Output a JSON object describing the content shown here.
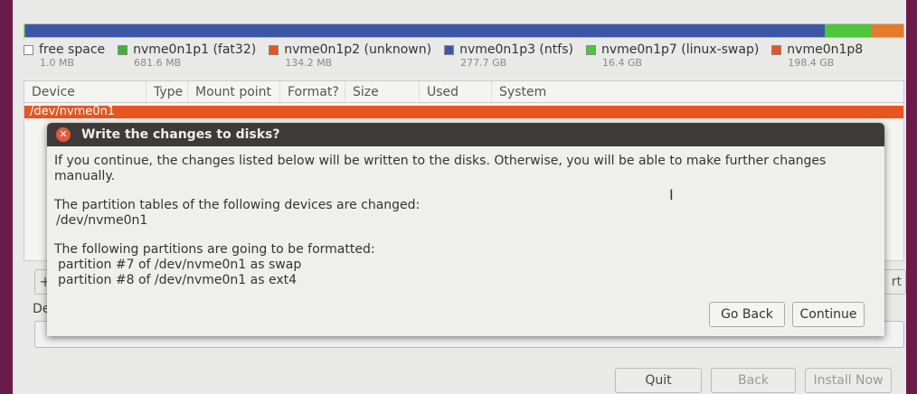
{
  "partition_bar": [
    {
      "color": "#ffffff",
      "pct": 0.0
    },
    {
      "color": "#3bb33b",
      "pct": 0.1
    },
    {
      "color": "#e95420",
      "pct": 0.05
    },
    {
      "color": "#3c56a8",
      "pct": 90.9
    },
    {
      "color": "#4cc73a",
      "pct": 5.3
    },
    {
      "color": "#e67a2a",
      "pct": 3.6
    }
  ],
  "legend": [
    {
      "label": "free space",
      "size": "1.0 MB",
      "color": "#ffffff"
    },
    {
      "label": "nvme0n1p1 (fat32)",
      "size": "681.6 MB",
      "color": "#3bb33b"
    },
    {
      "label": "nvme0n1p2 (unknown)",
      "size": "134.2 MB",
      "color": "#e95420"
    },
    {
      "label": "nvme0n1p3 (ntfs)",
      "size": "277.7 GB",
      "color": "#3c56a8"
    },
    {
      "label": "nvme0n1p7 (linux-swap)",
      "size": "16.4 GB",
      "color": "#4cc73a"
    },
    {
      "label": "nvme0n1p8",
      "size": "198.4 GB",
      "color": "#e95420"
    }
  ],
  "table": {
    "columns": [
      "Device",
      "Type",
      "Mount point",
      "Format?",
      "Size",
      "Used",
      "System"
    ],
    "selected_row": "/dev/nvme0n1"
  },
  "background": {
    "device_label": "De",
    "add_button": "+",
    "right_button": "rt"
  },
  "dialog": {
    "title": "Write the changes to disks?",
    "intro": "If you continue, the changes listed below will be written to the disks. Otherwise, you will be able to make further changes manually.",
    "tables_heading": "The partition tables of the following devices are changed:",
    "tables_items": [
      "/dev/nvme0n1"
    ],
    "format_heading": "The following partitions are going to be formatted:",
    "format_items": [
      "partition #7 of /dev/nvme0n1 as swap",
      "partition #8 of /dev/nvme0n1 as ext4"
    ],
    "go_back": "Go Back",
    "continue": "Continue"
  },
  "footer": {
    "quit": "Quit",
    "back": "Back",
    "install_now": "Install Now"
  }
}
